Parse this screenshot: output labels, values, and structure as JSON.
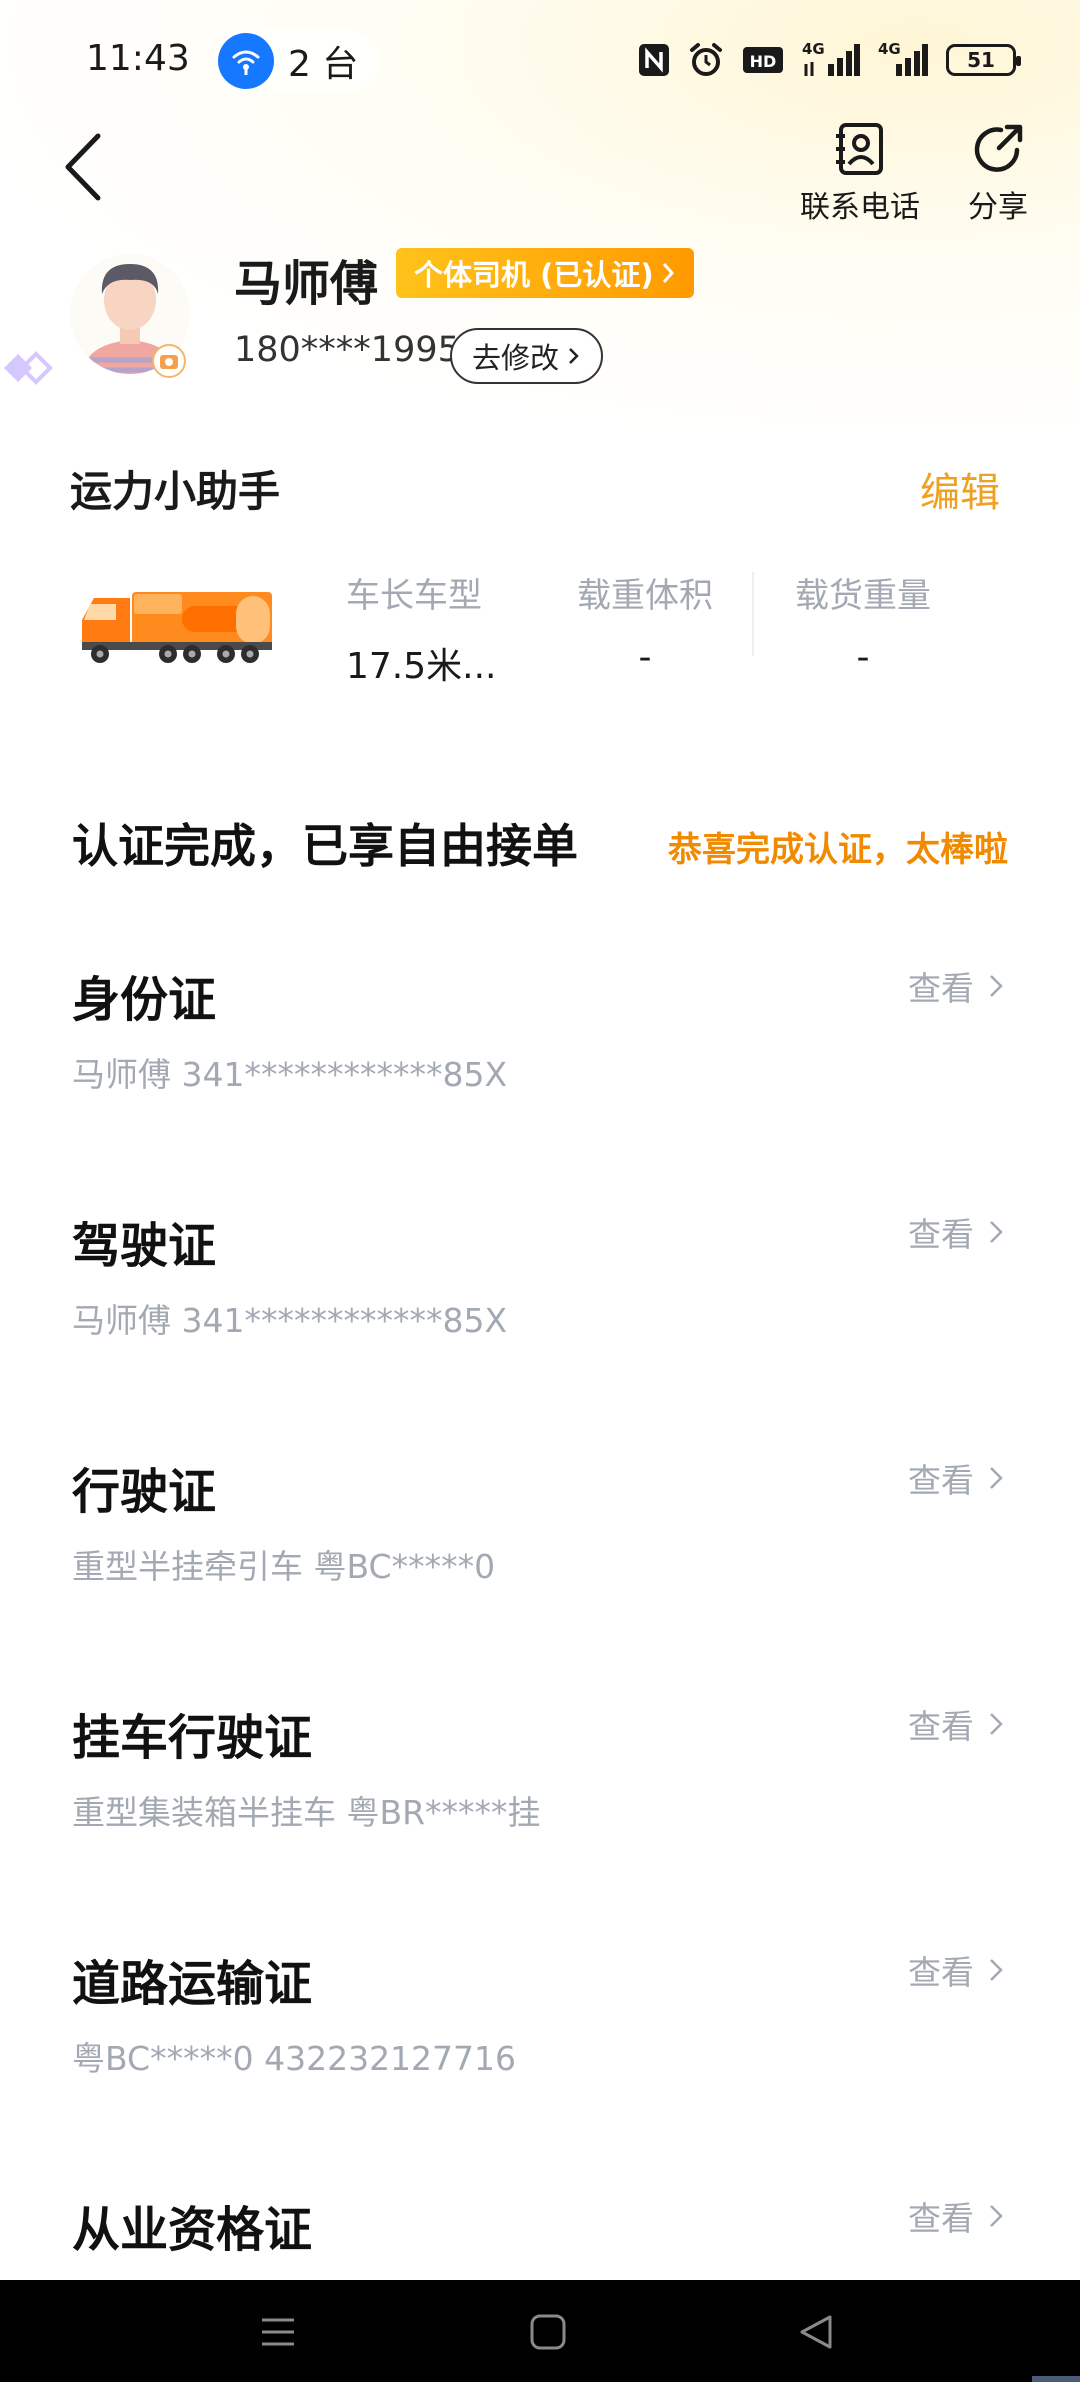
{
  "status_bar": {
    "time": "11:43",
    "hotspot_count": "2 台",
    "network_1": "4G",
    "network_2": "4G",
    "battery": "51",
    "icons": [
      "nfc-icon",
      "alarm-icon",
      "hd-icon",
      "signal-icon",
      "signal-icon",
      "battery-icon"
    ]
  },
  "header": {
    "contact_label": "联系电话",
    "share_label": "分享",
    "icons": [
      "back-arrow-icon",
      "contact-book-icon",
      "share-icon"
    ]
  },
  "profile": {
    "name": "马师傅",
    "badge": "个体司机 (已认证)",
    "phone": "180****1995",
    "edit_phone_label": "去修改",
    "badge_color": "#ff9a00"
  },
  "helper": {
    "title": "运力小助手",
    "edit_label": "编辑",
    "specs": [
      {
        "label": "车长车型",
        "value": "17.5米..."
      },
      {
        "label": "载重体积",
        "value": "-"
      },
      {
        "label": "载货重量",
        "value": "-"
      }
    ]
  },
  "certification": {
    "title": "认证完成，已享自由接单",
    "note": "恭喜完成认证，太棒啦",
    "note_color": "#f08a00",
    "items": [
      {
        "name": "身份证",
        "detail": "马师傅 341************85X",
        "action": "查看"
      },
      {
        "name": "驾驶证",
        "detail": "马师傅 341************85X",
        "action": "查看"
      },
      {
        "name": "行驶证",
        "detail": "重型半挂牵引车 粤BC*****0",
        "action": "查看"
      },
      {
        "name": "挂车行驶证",
        "detail": "重型集装箱半挂车 粤BR*****挂",
        "action": "查看"
      },
      {
        "name": "道路运输证",
        "detail": "粤BC*****0 432232127716",
        "action": "查看"
      },
      {
        "name": "从业资格证",
        "detail": "",
        "action": "查看"
      }
    ]
  },
  "nav_bar": {
    "icons": [
      "menu-icon",
      "home-icon",
      "back-icon"
    ]
  }
}
